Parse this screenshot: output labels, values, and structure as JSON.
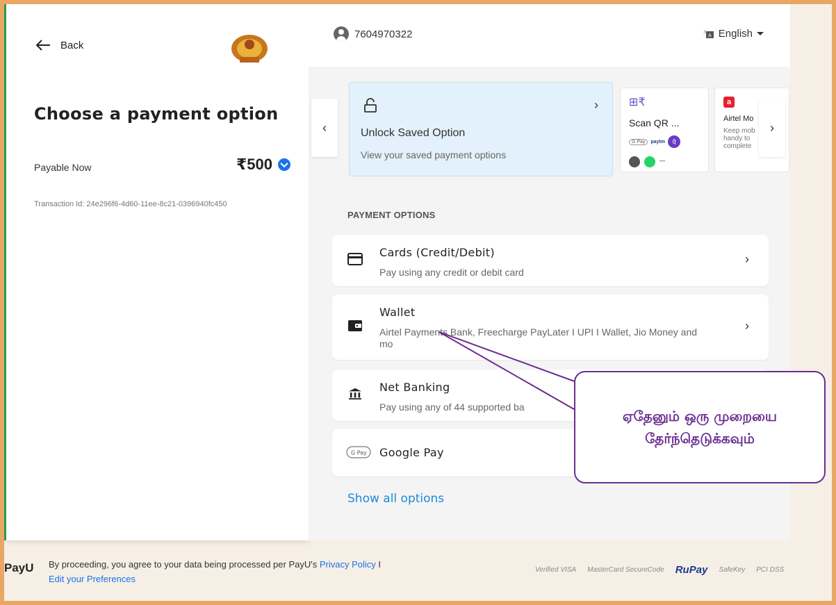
{
  "left": {
    "back_label": "Back",
    "title": "Choose a payment option",
    "payable_label": "Payable Now",
    "amount": "₹500",
    "transaction": "Transaction Id: 24e296f6-4d60-11ee-8c21-0396940fc450"
  },
  "header": {
    "phone": "7604970322",
    "language": "English"
  },
  "saved": {
    "title": "Unlock Saved Option",
    "subtitle": "View your saved payment options"
  },
  "qr": {
    "title": "Scan QR ...",
    "chip_g": "G Pay",
    "chip_p": "paytm",
    "chip_pe": "पे"
  },
  "airtel": {
    "title": "Airtel Mo",
    "subtitle": "Keep mob handy to complete"
  },
  "section_label": "PAYMENT OPTIONS",
  "options": [
    {
      "name": "Cards (Credit/Debit)",
      "desc": "Pay using any credit or debit card"
    },
    {
      "name": "Wallet",
      "desc": "Airtel Payments Bank, Freecharge PayLater I UPI I Wallet, Jio Money and mo"
    },
    {
      "name": "Net Banking",
      "desc": "Pay using any of 44 supported ba"
    },
    {
      "name": "Google Pay",
      "desc": ""
    }
  ],
  "show_all": "Show all options",
  "footer": {
    "logo": "PayU",
    "text": "By proceeding, you agree to your data being processed per PayU's",
    "privacy": "Privacy Policy",
    "sep": "I",
    "edit": "Edit your Preferences"
  },
  "badges": [
    "Verified VISA",
    "MasterCard SecureCode",
    "RuPay",
    "SafeKey",
    "PCI DSS"
  ],
  "callout": "ஏதேனும் ஒரு முறையை தேர்ந்தெடுக்கவும்",
  "colors": {
    "accent": "#1a8cd8",
    "callout": "#6a2c91",
    "frame": "#e8a765"
  }
}
